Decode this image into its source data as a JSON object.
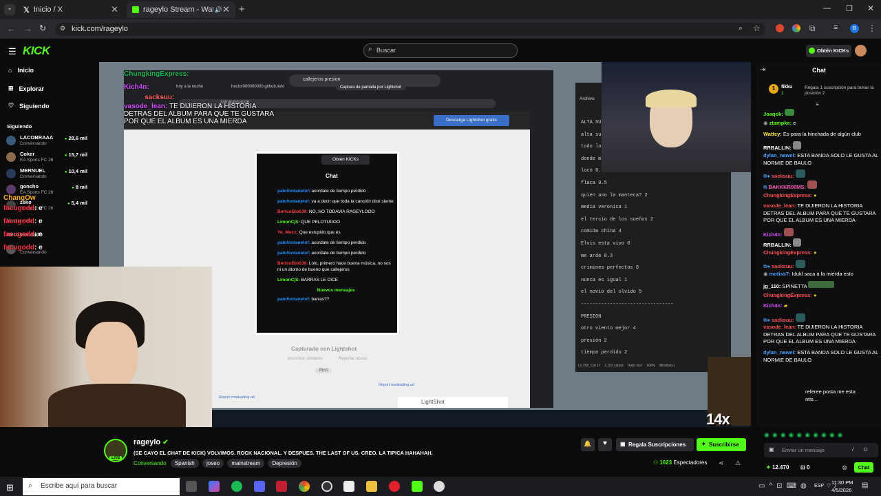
{
  "browser": {
    "tabs": [
      {
        "label": "Inicio / X"
      },
      {
        "label": "rageylo Stream - Watch Live"
      }
    ],
    "url": "kick.com/rageylo"
  },
  "kick": {
    "logo": "KICK",
    "search_placeholder": "Buscar",
    "obten_kicks": "Obtén KICKs",
    "nav": [
      {
        "label": "Inicio"
      },
      {
        "label": "Explorar"
      },
      {
        "label": "Siguiendo"
      }
    ],
    "following_header": "Siguiendo",
    "following": [
      {
        "name": "LACOBRAAA",
        "game": "Conversando",
        "viewers": "28,6 mil"
      },
      {
        "name": "Coker",
        "game": "EA Sports FC 26",
        "viewers": "15,7 mil"
      },
      {
        "name": "MERNUEL",
        "game": "Conversando",
        "viewers": "10,4 mil"
      },
      {
        "name": "goncho",
        "game": "EA Sports FC 26",
        "viewers": "8 mil"
      },
      {
        "name": "zeko",
        "game": "EA Sports FC 26",
        "viewers": "5,4 mil"
      }
    ],
    "show_more": "Mostrar más",
    "recommended_header": "Recomendado",
    "recommended_sub": "Conversando"
  },
  "stream": {
    "overlay_chat": [
      {
        "user": "ChungkingExpress:",
        "text": ""
      },
      {
        "user": "Kich4n:",
        "text": ""
      },
      {
        "user": "sacksuu:",
        "text": ""
      },
      {
        "user": "vasode_lean:",
        "text": "TE DIJIERON LA HISTORIA"
      },
      {
        "user": "",
        "text": "DETRAS DEL ALBUM PARA QUE TE GUSTARA"
      },
      {
        "user": "",
        "text": "POR QUE EL ALBUM ES UNA MIERDA"
      }
    ],
    "overlay_left": [
      {
        "user": "ChangOw",
        "text": ""
      },
      {
        "user": "facugodd",
        "text": ": e"
      },
      {
        "user": "facugodd",
        "text": ": e"
      },
      {
        "user": "facugodd",
        "text": ": e"
      },
      {
        "user": "facugodd",
        "text": ": e"
      }
    ],
    "inner_tabs": [
      "hoy a la noche",
      "hector000000000.github.io/lo",
      "Captura de pantalla por Lightshot"
    ],
    "inner_url": "3dKdk4b3cKi06",
    "lightshot_download": "Descarga Lightshot gratis",
    "lightshot_caption": "Capturado con Lightshot",
    "lightshot_similar": "encontrar similares",
    "lightshot_report": "Reportar abuso",
    "lightshot_post": "Post",
    "report_misleading": "Report misleading ad",
    "lightshot_brand": "LightShot",
    "inner_chat_title": "Chat",
    "inner_obten": "Obtén KICKs",
    "inner_chat": [
      {
        "user": "patofontanetof:",
        "text": "acordate de tiempo perdido"
      },
      {
        "user": "patofontanetof:",
        "text": "va a decir que toda la canción dice siente"
      },
      {
        "user": "BertsoDio0J8:",
        "text": "NO, NO TODAVIA RAGEYLOOO"
      },
      {
        "user": "LimonCjS:",
        "text": "QUE PELOTUDOO"
      },
      {
        "user": "Yo_Mexx:",
        "text": "Que estupido que es"
      },
      {
        "user": "patofontanetof:",
        "text": "acordate de tiempo perdido"
      },
      {
        "user": "patofontanetof:",
        "text": "acordate de tiempo perdido"
      },
      {
        "user": "BertsoDio0J8:",
        "text": "Lolo, primero hace buena música, no sos ni un átomo de bueno que callejeros"
      },
      {
        "user": "LimonCjS:",
        "text": "BARRAS LE DICE"
      },
      {
        "user": "patofontanetof:",
        "text": "barras??"
      }
    ],
    "new_messages": "Nuevos mensajes",
    "search_inner": "callejeros presion",
    "notepad_title": "Archivo",
    "notepad_lines": [
      "ALTA SU",
      "alta su",
      "todo lo",
      "donde m",
      "loco 8.",
      "flaca 9.5",
      "quien aso la manteca? 2",
      "media veronica 1",
      "el tercio de los sueños 2",
      "comida china 4",
      "Elvis esta vivo 0",
      "me arde 8.3",
      "crimines perfectos 8",
      "nunca es igual 1",
      "el novio del olvido 5",
      "--------------------------------",
      "PRESION",
      "otro viento mejor 4",
      "presión 2",
      "tiempo perdido 2"
    ],
    "notepad_status": "Ln 250, Col 17    2,152 caract    Texto sin f    100%    Windows (",
    "streak": "14x STREAK"
  },
  "chat": {
    "title": "Chat",
    "pinned_user": "fikku",
    "pinned_count": "1",
    "pinned_text": "Regala 1 suscripción para tomar la posición 2",
    "messages": [
      {
        "user": "Joaqok:",
        "text": ""
      },
      {
        "user": "ztampke:",
        "text": "e"
      },
      {
        "user": "Wattcy:",
        "text": "Es para la hinchada de algún club"
      },
      {
        "user": "RRBALLIN:",
        "text": ""
      },
      {
        "user": "dylan_nawel:",
        "text": "ESTA BANDA SOLO LE GUSTA AL NORMIE DE BAULO"
      },
      {
        "user": "sacksuu:",
        "text": ""
      },
      {
        "user": "BAKKKR00MS:",
        "text": ""
      },
      {
        "user": "ChungkingExpress:",
        "text": ""
      },
      {
        "user": "vasode_lean:",
        "text": "TE DIJIERON LA HISTORIA DETRAS DEL ALBUM PARA QUE TE GUSTARA POR QUE EL ALBUM ES UNA MIERDA"
      },
      {
        "user": "Kich4n:",
        "text": ""
      },
      {
        "user": "RRBALLIN:",
        "text": ""
      },
      {
        "user": "ChungkingExpress:",
        "text": ""
      },
      {
        "user": "sacksuu:",
        "text": ""
      },
      {
        "user": "motiss7:",
        "text": "Idukl saca a la mierda esto"
      },
      {
        "user": "jg_110:",
        "text": "SPINETTA"
      },
      {
        "user": "ChungkingExpress:",
        "text": ""
      },
      {
        "user": "Kich4n:",
        "text": ""
      },
      {
        "user": "sacksuu:",
        "text": ""
      },
      {
        "user": "vasode_lean:",
        "text": "TE DIJIERON LA HISTORIA DETRAS DEL ALBUM PARA QUE TE GUSTARA POR QUE EL ALBUM ES UNA MIERDA"
      },
      {
        "user": "dylan_nawel:",
        "text": "ESTA BANDA SOLO LE GUSTA AL NORMIE DE BAULO"
      },
      {
        "user": "",
        "text": "referee posta me esta"
      },
      {
        "user": "",
        "text": "ntis..."
      }
    ],
    "input_placeholder": "Enviar un mensaje",
    "kicks_count": "12.470",
    "zero_count": "0",
    "send_label": "Chat"
  },
  "channel": {
    "name": "rageylo",
    "live_badge": "LIVE",
    "title": "(SE CAYO EL CHAT DE KICK) VOLVIMOS. ROCK NACIONAL. Y DESPUES. THE LAST OF US. CREO. LA TIPICA HAHAHAH.",
    "category": "Conversando",
    "tags": [
      "Spanish",
      "joseo",
      "mainstream",
      "Depresión"
    ],
    "gift_subs": "Regala Suscripciones",
    "subscribe": "Suscribirse",
    "viewers": "1623",
    "viewers_label": "Espectadores"
  },
  "taskbar": {
    "search_placeholder": "Escribe aquí para buscar",
    "lang": "ESP",
    "time": "11:30 PM",
    "date": "4/5/2026"
  },
  "colors": {
    "kick_green": "#53fc18",
    "bg": "#0b0b0c"
  }
}
